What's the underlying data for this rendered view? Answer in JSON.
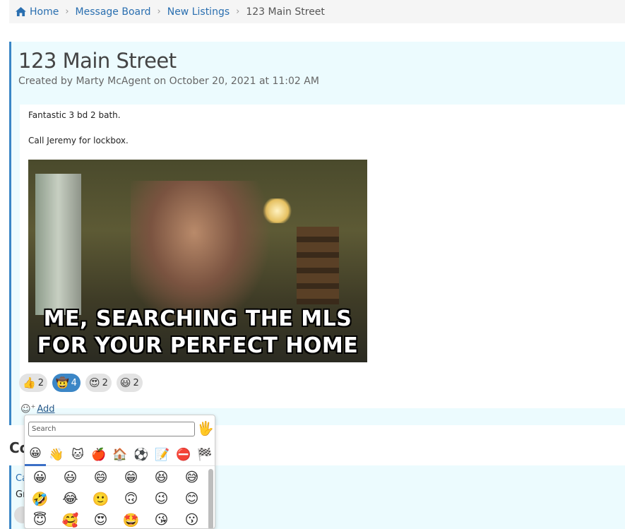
{
  "breadcrumb": {
    "home": "Home",
    "message_board": "Message Board",
    "new_listings": "New Listings",
    "current": "123 Main Street",
    "separator": "›"
  },
  "post": {
    "title": "123 Main Street",
    "meta": "Created by Marty McAgent on October 20, 2021 at 11:02 AM",
    "body_line1": "Fantastic 3 bd 2 bath.",
    "body_line2": "Call Jeremy for lockbox.",
    "gif_caption_line1": "ME, SEARCHING THE MLS",
    "gif_caption_line2": "FOR YOUR PERFECT HOME"
  },
  "reactions": [
    {
      "emoji": "👍",
      "count": "2",
      "active": false
    },
    {
      "emoji": "🤠",
      "count": "4",
      "active": true
    },
    {
      "emoji": "😍",
      "count": "2",
      "active": false
    },
    {
      "emoji": "😃",
      "count": "2",
      "active": false
    }
  ],
  "add_reaction": {
    "icon": "☺",
    "plus": "+",
    "label": "Add"
  },
  "comments": {
    "heading": "Co",
    "first_author": "Ca",
    "first_text": "Gr"
  },
  "picker": {
    "search_placeholder": "Search",
    "skin_tone": "🖐",
    "categories": [
      "😀",
      "👋",
      "🐱",
      "🍎",
      "🏠",
      "⚽",
      "📝",
      "⛔",
      "🏁"
    ],
    "emojis": [
      "😀",
      "😃",
      "😄",
      "😁",
      "😆",
      "😅",
      "🤣",
      "😂",
      "🙂",
      "🙃",
      "😉",
      "😊",
      "😇",
      "🥰",
      "😍",
      "🤩",
      "😘",
      "😗"
    ]
  },
  "colors": {
    "accent": "#3b86c6",
    "card_background": "#ecfbfe",
    "link": "#2a6fb0"
  }
}
